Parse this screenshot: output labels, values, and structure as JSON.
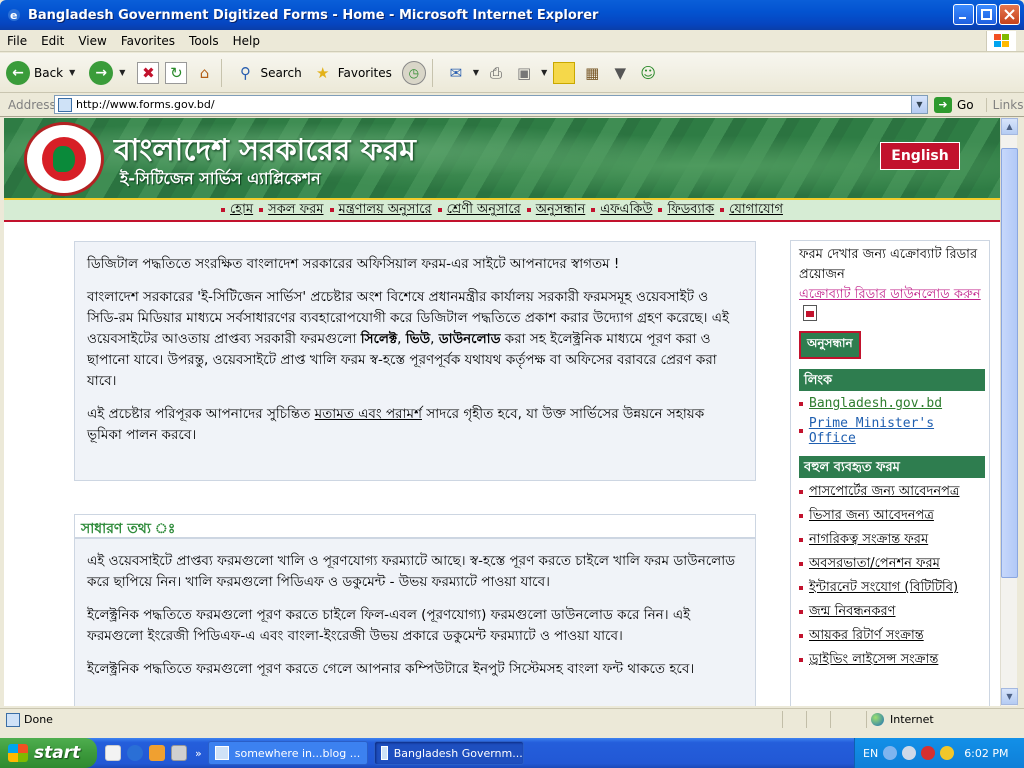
{
  "window": {
    "title": "Bangladesh Government Digitized Forms - Home - Microsoft Internet Explorer"
  },
  "menubar": {
    "items": [
      "File",
      "Edit",
      "View",
      "Favorites",
      "Tools",
      "Help"
    ]
  },
  "toolbar": {
    "back_label": "Back",
    "search_label": "Search",
    "favorites_label": "Favorites"
  },
  "address": {
    "label": "Address",
    "url": "http://www.forms.gov.bd/",
    "go_label": "Go",
    "links_label": "Links"
  },
  "site": {
    "title": "বাংলাদেশ সরকারের ফরম",
    "subtitle": "ই-সিটিজেন সার্ভিস এ্যাপ্লিকেশন",
    "english_label": "English",
    "nav": [
      "হোম",
      "সকল ফরম",
      "মন্ত্রণালয় অনুসারে",
      "শ্রেণী অনুসারে",
      "অনুসন্ধান",
      "এফএকিউ",
      "ফিডব্যাক",
      "যোগাযোগ"
    ]
  },
  "welcome": {
    "p1": "ডিজিটাল পদ্ধতিতে সংরক্ষিত বাংলাদেশ সরকারের অফিসিয়াল ফরম-এর সাইটে আপনাদের স্বাগতম !",
    "p2_a": "বাংলাদেশ সরকারের 'ই-সিটিজেন সার্ভিস' প্রচেষ্টার অংশ বিশেষে প্রধানমন্ত্রীর কার্যালয় সরকারী ফরমসমূহ ওয়েবসাইট ও সিডি-রম মিডিয়ার মাধ্যমে সর্বসাধারণের ব্যবহারোপযোগী করে ডিজিটাল পদ্ধতিতে প্রকাশ করার উদ্যোগ গ্রহণ করেছে। এই ওয়েবসাইটের আওতায় প্রাপ্তব্য সরকারী ফরমগুলো ",
    "p2_b1": "সিলেক্ট",
    "p2_sep1": ", ",
    "p2_b2": "ভিউ",
    "p2_sep2": ", ",
    "p2_b3": "ডাউনলোড",
    "p2_c": " করা সহ ইলেক্ট্রনিক মাধ্যমে পূরণ করা ও ছাপানো যাবে। উপরন্তু, ওয়েবসাইটে প্রাপ্ত খালি ফরম স্ব-হস্তে পূরণপূর্বক যথাযথ কর্তৃপক্ষ বা অফিসের বরাবরে প্রেরণ করা যাবে।",
    "p3_a": "এই প্রচেষ্টার পরিপূরক আপনাদের সুচিন্তিত ",
    "p3_link": "মতামত এবং পরামর্শ",
    "p3_b": " সাদরে গৃহীত হবে, যা উক্ত সার্ভিসের উন্নয়নে সহায়ক ভূমিকা পালন করবে।"
  },
  "info": {
    "heading": "সাধারণ তথ্য ঃ",
    "p1": "এই ওয়েবসাইটে প্রাপ্তব্য ফরমগুলো খালি ও পূরণযোগ্য ফরম্যাটে আছে। স্ব-হস্তে পূরণ করতে চাইলে খালি ফরম ডাউনলোড করে ছাপিয়ে নিন। খালি ফরমগুলো পিডিএফ ও ডকুমেন্ট - উভয় ফরম্যাটে পাওয়া যাবে।",
    "p2": "ইলেক্ট্রনিক পদ্ধতিতে ফরমগুলো পূরণ করতে চাইলে ফিল-এবল (পূরণযোগ্য) ফরমগুলো ডাউনলোড করে নিন। এই ফরমগুলো ইংরেজী পিডিএফ-এ এবং বাংলা-ইংরেজী উভয় প্রকারে ডকুমেন্ট ফরম্যাটে ও পাওয়া যাবে।",
    "p3": "ইলেক্ট্রনিক পদ্ধতিতে ফরমগুলো পূরণ করতে গেলে আপনার কম্পিউটারে ইনপুট সিস্টেমসহ বাংলা ফন্ট থাকতে হবে।"
  },
  "sidebar": {
    "reader_note": "ফরম দেখার জন্য এক্রোব্যাট রিডার প্রয়োজন",
    "reader_link": "এক্রোব্যাট রিডার ডাউনলোড করুন",
    "search_label": "অনুসন্ধান",
    "links_heading": "লিংক",
    "links": [
      "Bangladesh.gov.bd",
      "Prime Minister's Office"
    ],
    "forms_heading": "বহুল ব্যবহৃত ফরম",
    "forms": [
      "পাসপোর্টের জন্য আবেদনপত্র",
      "ভিসার জন্য আবেদনপত্র",
      "নাগরিকত্ব সংক্রান্ত ফরম",
      "অবসরভাতা/পেনশন ফরম",
      "ইন্টারনেট সংযোগ (বিটিটিবি)",
      "জন্ম নিবন্ধনকরণ",
      "আয়কর রিটার্ণ সংক্রান্ত",
      "ড্রাইভিং লাইসেন্স সংক্রান্ত"
    ]
  },
  "status": {
    "text": "Done",
    "zone": "Internet"
  },
  "taskbar": {
    "start_label": "start",
    "tasks": [
      "somewhere in...blog ...",
      "Bangladesh Governm..."
    ],
    "lang": "EN",
    "clock": "6:02 PM"
  },
  "colors": {
    "header_green": "#2e7c44",
    "accent_red": "#c2122d",
    "sidebar_green": "#2e7d4f",
    "link_pink": "#c0208a",
    "info_green": "#2e8b3a"
  }
}
